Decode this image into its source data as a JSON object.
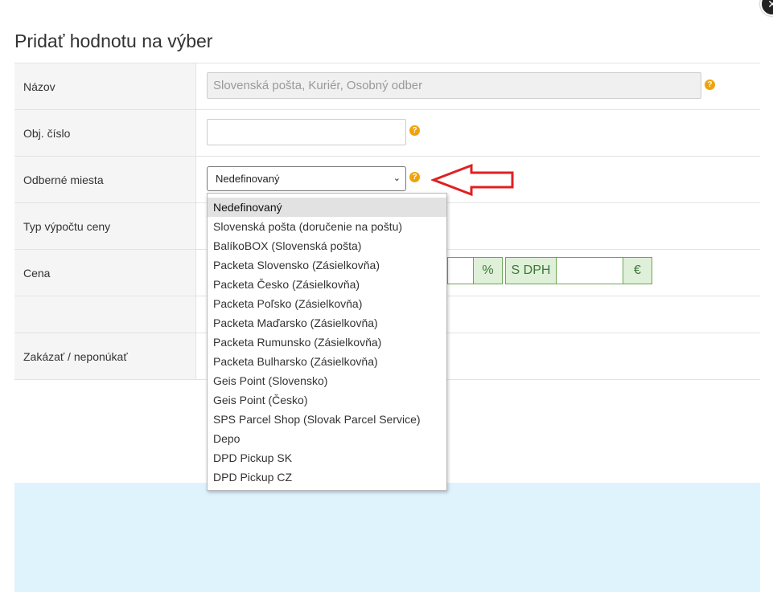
{
  "dialog": {
    "title": "Pridať hodnotu na výber",
    "close_glyph": "✕"
  },
  "form": {
    "name": {
      "label": "Názov",
      "placeholder": "Slovenská pošta, Kuriér, Osobný odber"
    },
    "code": {
      "label": "Obj. číslo",
      "value": ""
    },
    "pickup": {
      "label": "Odberné miesta",
      "selected": "Nedefinovaný"
    },
    "price_type": {
      "label": "Typ výpočtu ceny"
    },
    "price": {
      "label": "Cena",
      "percent_addon": "%",
      "vat_addon": "S DPH",
      "currency_addon": "€"
    },
    "disable": {
      "label": "Zakázať / neponúkať"
    }
  },
  "help_glyph": "?",
  "dropdown_options": [
    "Nedefinovaný",
    "Slovenská pošta (doručenie na poštu)",
    "BalíkoBOX (Slovenská pošta)",
    "Packeta Slovensko (Zásielkovňa)",
    "Packeta Česko (Zásielkovňa)",
    "Packeta Poľsko (Zásielkovňa)",
    "Packeta Maďarsko (Zásielkovňa)",
    "Packeta Rumunsko (Zásielkovňa)",
    "Packeta Bulharsko (Zásielkovňa)",
    "Geis Point (Slovensko)",
    "Geis Point (Česko)",
    "SPS Parcel Shop (Slovak Parcel Service)",
    "Depo",
    "DPD Pickup SK",
    "DPD Pickup CZ"
  ],
  "colors": {
    "help": "#f0a30a",
    "arrow": "#e02020",
    "addon_green": "#dff0d8",
    "info_blue": "#dff3fd"
  },
  "icons": {
    "help": "question-circle-icon",
    "close": "close-icon",
    "arrow": "arrow-left-icon"
  }
}
